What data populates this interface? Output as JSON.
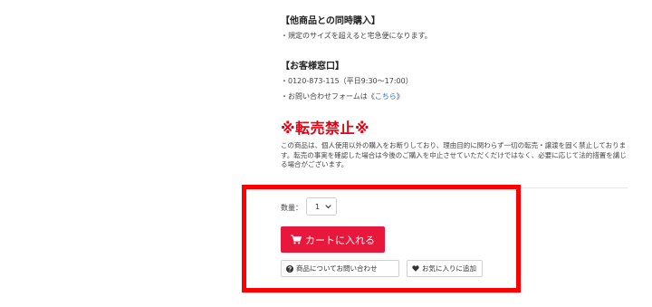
{
  "sections": {
    "combined_purchase": {
      "title": "【他商品との同時購入】",
      "line1": "・規定のサイズを超えると宅急便になります。"
    },
    "contact": {
      "title": "【お客様窓口】",
      "phone_line": "・0120-873-115（平日9:30〜17:00）",
      "form_prefix": "・お問い合わせフォームは",
      "form_bracket_open": "《",
      "form_link": "こちら",
      "form_bracket_close": "》"
    }
  },
  "warning": {
    "title": "※転売禁止※",
    "body": "この商品は、個人使用以外の購入をお断りしており、理由目的に関わらず一切の転売・譲渡を固く禁止しております。転売の事実を確認した場合は今後のご購入を中止させていただくだけではなく、必要に応じて法的措置を講じる場合がございます。"
  },
  "purchase": {
    "quantity_label": "数量：",
    "quantity_value": "1",
    "cart_button_label": "カートに入れる",
    "inquiry_button_label": "商品についてお問い合わせ",
    "favorite_button_label": "お気に入りに追加"
  },
  "icons": {
    "cart": "cart-icon",
    "question": "question-circle-icon",
    "heart": "heart-icon",
    "chevron": "chevron-down-icon"
  },
  "colors": {
    "accent_red": "#e60012",
    "cart_button": "#e8173c",
    "highlight_border": "#ff0000",
    "link": "#2a6ebb"
  }
}
